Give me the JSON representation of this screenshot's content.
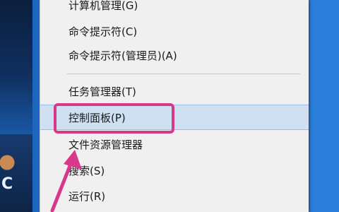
{
  "menu": {
    "items": [
      {
        "label": "计算机管理(G)"
      },
      {
        "label": "命令提示符(C)"
      },
      {
        "label": "命令提示符(管理员)(A)"
      },
      {
        "label": "任务管理器(T)"
      },
      {
        "label": "控制面板(P)"
      },
      {
        "label": "文件资源管理器"
      },
      {
        "label": "搜索(S)"
      },
      {
        "label": "运行(R)"
      }
    ],
    "highlighted": "控制面板(P)"
  },
  "desktop": {
    "partial_text": "C"
  },
  "annotation": {
    "color": "#d9388a"
  }
}
